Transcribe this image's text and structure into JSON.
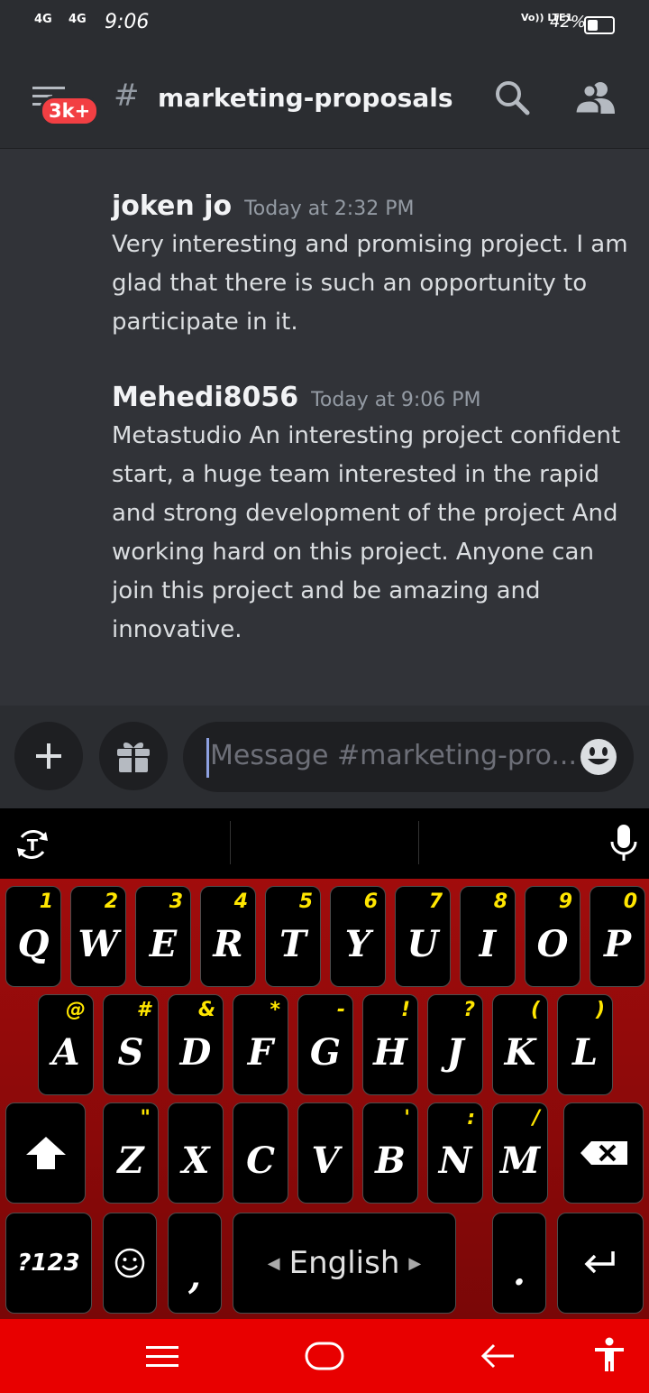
{
  "status_bar": {
    "signal_1": "4G",
    "signal_2": "4G",
    "time": "9:06",
    "volte": "Vo)) LTE1",
    "battery": "42%",
    "battery_level": 0.42
  },
  "header": {
    "badge": "3k+",
    "hash": "#",
    "channel_name": "marketing-proposals"
  },
  "messages": [
    {
      "author": "joken  jo",
      "timestamp": "Today at 2:32 PM",
      "text": "Very interesting and promising project. I am glad that there is such an opportunity to participate in it."
    },
    {
      "author": "Mehedi8056",
      "timestamp": "Today at 9:06 PM",
      "text": "Metastudio An interesting project confident start, a huge team interested in the rapid and strong development of the project And working hard on this project. Anyone can join this project and be amazing and innovative."
    }
  ],
  "composer": {
    "placeholder": "Message #marketing-pro..."
  },
  "keyboard": {
    "row1": [
      {
        "label": "Q",
        "hint": "1"
      },
      {
        "label": "W",
        "hint": "2"
      },
      {
        "label": "E",
        "hint": "3"
      },
      {
        "label": "R",
        "hint": "4"
      },
      {
        "label": "T",
        "hint": "5"
      },
      {
        "label": "Y",
        "hint": "6"
      },
      {
        "label": "U",
        "hint": "7"
      },
      {
        "label": "I",
        "hint": "8"
      },
      {
        "label": "O",
        "hint": "9"
      },
      {
        "label": "P",
        "hint": "0"
      }
    ],
    "row2": [
      {
        "label": "A",
        "hint": "@"
      },
      {
        "label": "S",
        "hint": "#"
      },
      {
        "label": "D",
        "hint": "&"
      },
      {
        "label": "F",
        "hint": "*"
      },
      {
        "label": "G",
        "hint": "-"
      },
      {
        "label": "H",
        "hint": "!"
      },
      {
        "label": "J",
        "hint": "?"
      },
      {
        "label": "K",
        "hint": "("
      },
      {
        "label": "L",
        "hint": ")"
      }
    ],
    "row3": [
      {
        "label": "Z",
        "hint": "\""
      },
      {
        "label": "X",
        "hint": ""
      },
      {
        "label": "C",
        "hint": ""
      },
      {
        "label": "V",
        "hint": ""
      },
      {
        "label": "B",
        "hint": "'"
      },
      {
        "label": "N",
        "hint": ":"
      },
      {
        "label": "M",
        "hint": "/"
      }
    ],
    "symbols_key": "?123",
    "comma_key": ",",
    "space_key": "English",
    "period_key": "."
  },
  "colors": {
    "accent_badge": "#f23f43",
    "keyboard_bg": "#a10c0c",
    "navbar_bg": "#e80000",
    "hint_color": "#ffe600"
  }
}
